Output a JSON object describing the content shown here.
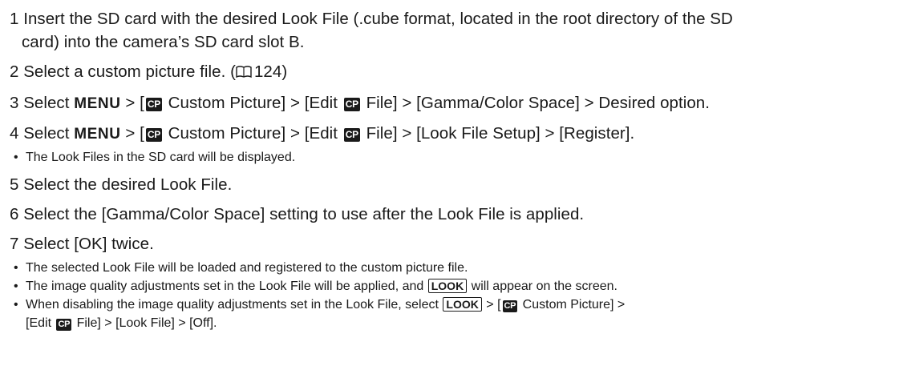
{
  "steps": [
    {
      "num": "1",
      "line1": "Insert the SD card with the desired Look File (.cube format, located in the root directory of the SD",
      "line2": "card) into the camera’s SD card slot B."
    },
    {
      "num": "2",
      "text_before": "Select a custom picture file. (",
      "page_ref": "124",
      "text_after": ")"
    },
    {
      "num": "3",
      "pre": "Select ",
      "menu": "MENU",
      "seg1": " > [",
      "cp": "CP",
      "seg2": " Custom Picture] > [Edit ",
      "seg3": " File] > [Gamma/Color Space] > Desired option."
    },
    {
      "num": "4",
      "pre": "Select ",
      "menu": "MENU",
      "seg1": " > [",
      "cp": "CP",
      "seg2": " Custom Picture] > [Edit ",
      "seg3": " File] > [Look File Setup] > [Register].",
      "bullets": [
        "The Look Files in the SD card will be displayed."
      ]
    },
    {
      "num": "5",
      "text": "Select the desired Look File."
    },
    {
      "num": "6",
      "text": "Select the [Gamma/Color Space] setting to use after the Look File is applied."
    },
    {
      "num": "7",
      "text": "Select [OK] twice.",
      "bullet1": "The selected Look File will be loaded and registered to the custom picture file.",
      "bullet2_pre": "The image quality adjustments set in the Look File will be applied, and ",
      "bullet2_icon": "LOOK",
      "bullet2_post": " will appear on the screen.",
      "bullet3_pre": "When disabling the image quality adjustments set in the Look File, select ",
      "bullet3_icon": "LOOK",
      "bullet3_mid": " > [",
      "bullet3_cp": "CP",
      "bullet3_mid2": " Custom Picture] >",
      "bullet3_line2_pre": "[Edit ",
      "bullet3_line2_post": " File] > [Look File] > [Off]."
    }
  ]
}
